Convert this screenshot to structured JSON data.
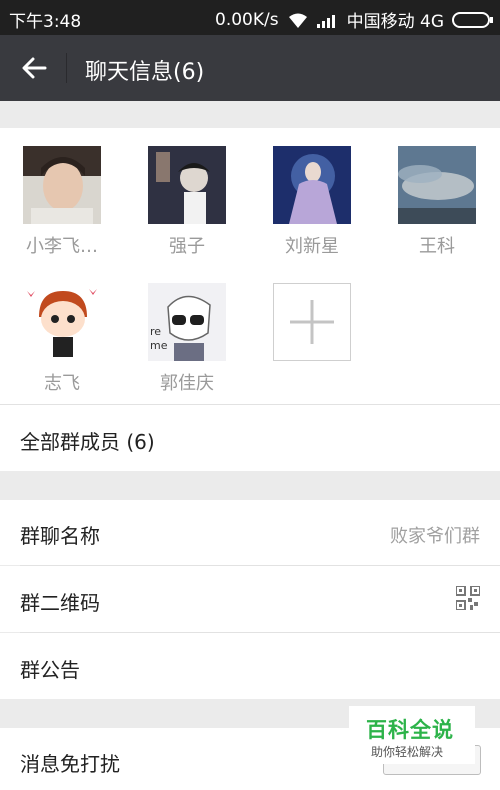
{
  "status_bar": {
    "time": "下午3:48",
    "speed": "0.00K/s",
    "carrier": "中国移动 4G"
  },
  "header": {
    "title": "聊天信息(6)",
    "back_icon": "arrow-left-icon"
  },
  "members": [
    {
      "name": "小李飞…",
      "avatar": "avatar-portrait"
    },
    {
      "name": "强子",
      "avatar": "avatar-album-cover"
    },
    {
      "name": "刘新星",
      "avatar": "avatar-fantasy-art"
    },
    {
      "name": "王科",
      "avatar": "avatar-sky"
    },
    {
      "name": "志飞",
      "avatar": "avatar-cartoon-boy"
    },
    {
      "name": "郭佳庆",
      "avatar": "avatar-sketch-sunglasses"
    }
  ],
  "add_member_icon": "plus-icon",
  "all_members": {
    "label": "全部群成员 (6)"
  },
  "settings": {
    "group_name": {
      "label": "群聊名称",
      "value": "败家爷们群"
    },
    "qr_code": {
      "label": "群二维码",
      "icon": "qr-code-icon"
    },
    "notice": {
      "label": "群公告"
    },
    "mute": {
      "label": "消息免打扰"
    }
  },
  "watermark": {
    "title": "百科全说",
    "subtitle": "助你轻松解决"
  },
  "colors": {
    "title_bar": "#393a3f",
    "status_bar": "#202020",
    "watermark_green": "#2db34a"
  }
}
